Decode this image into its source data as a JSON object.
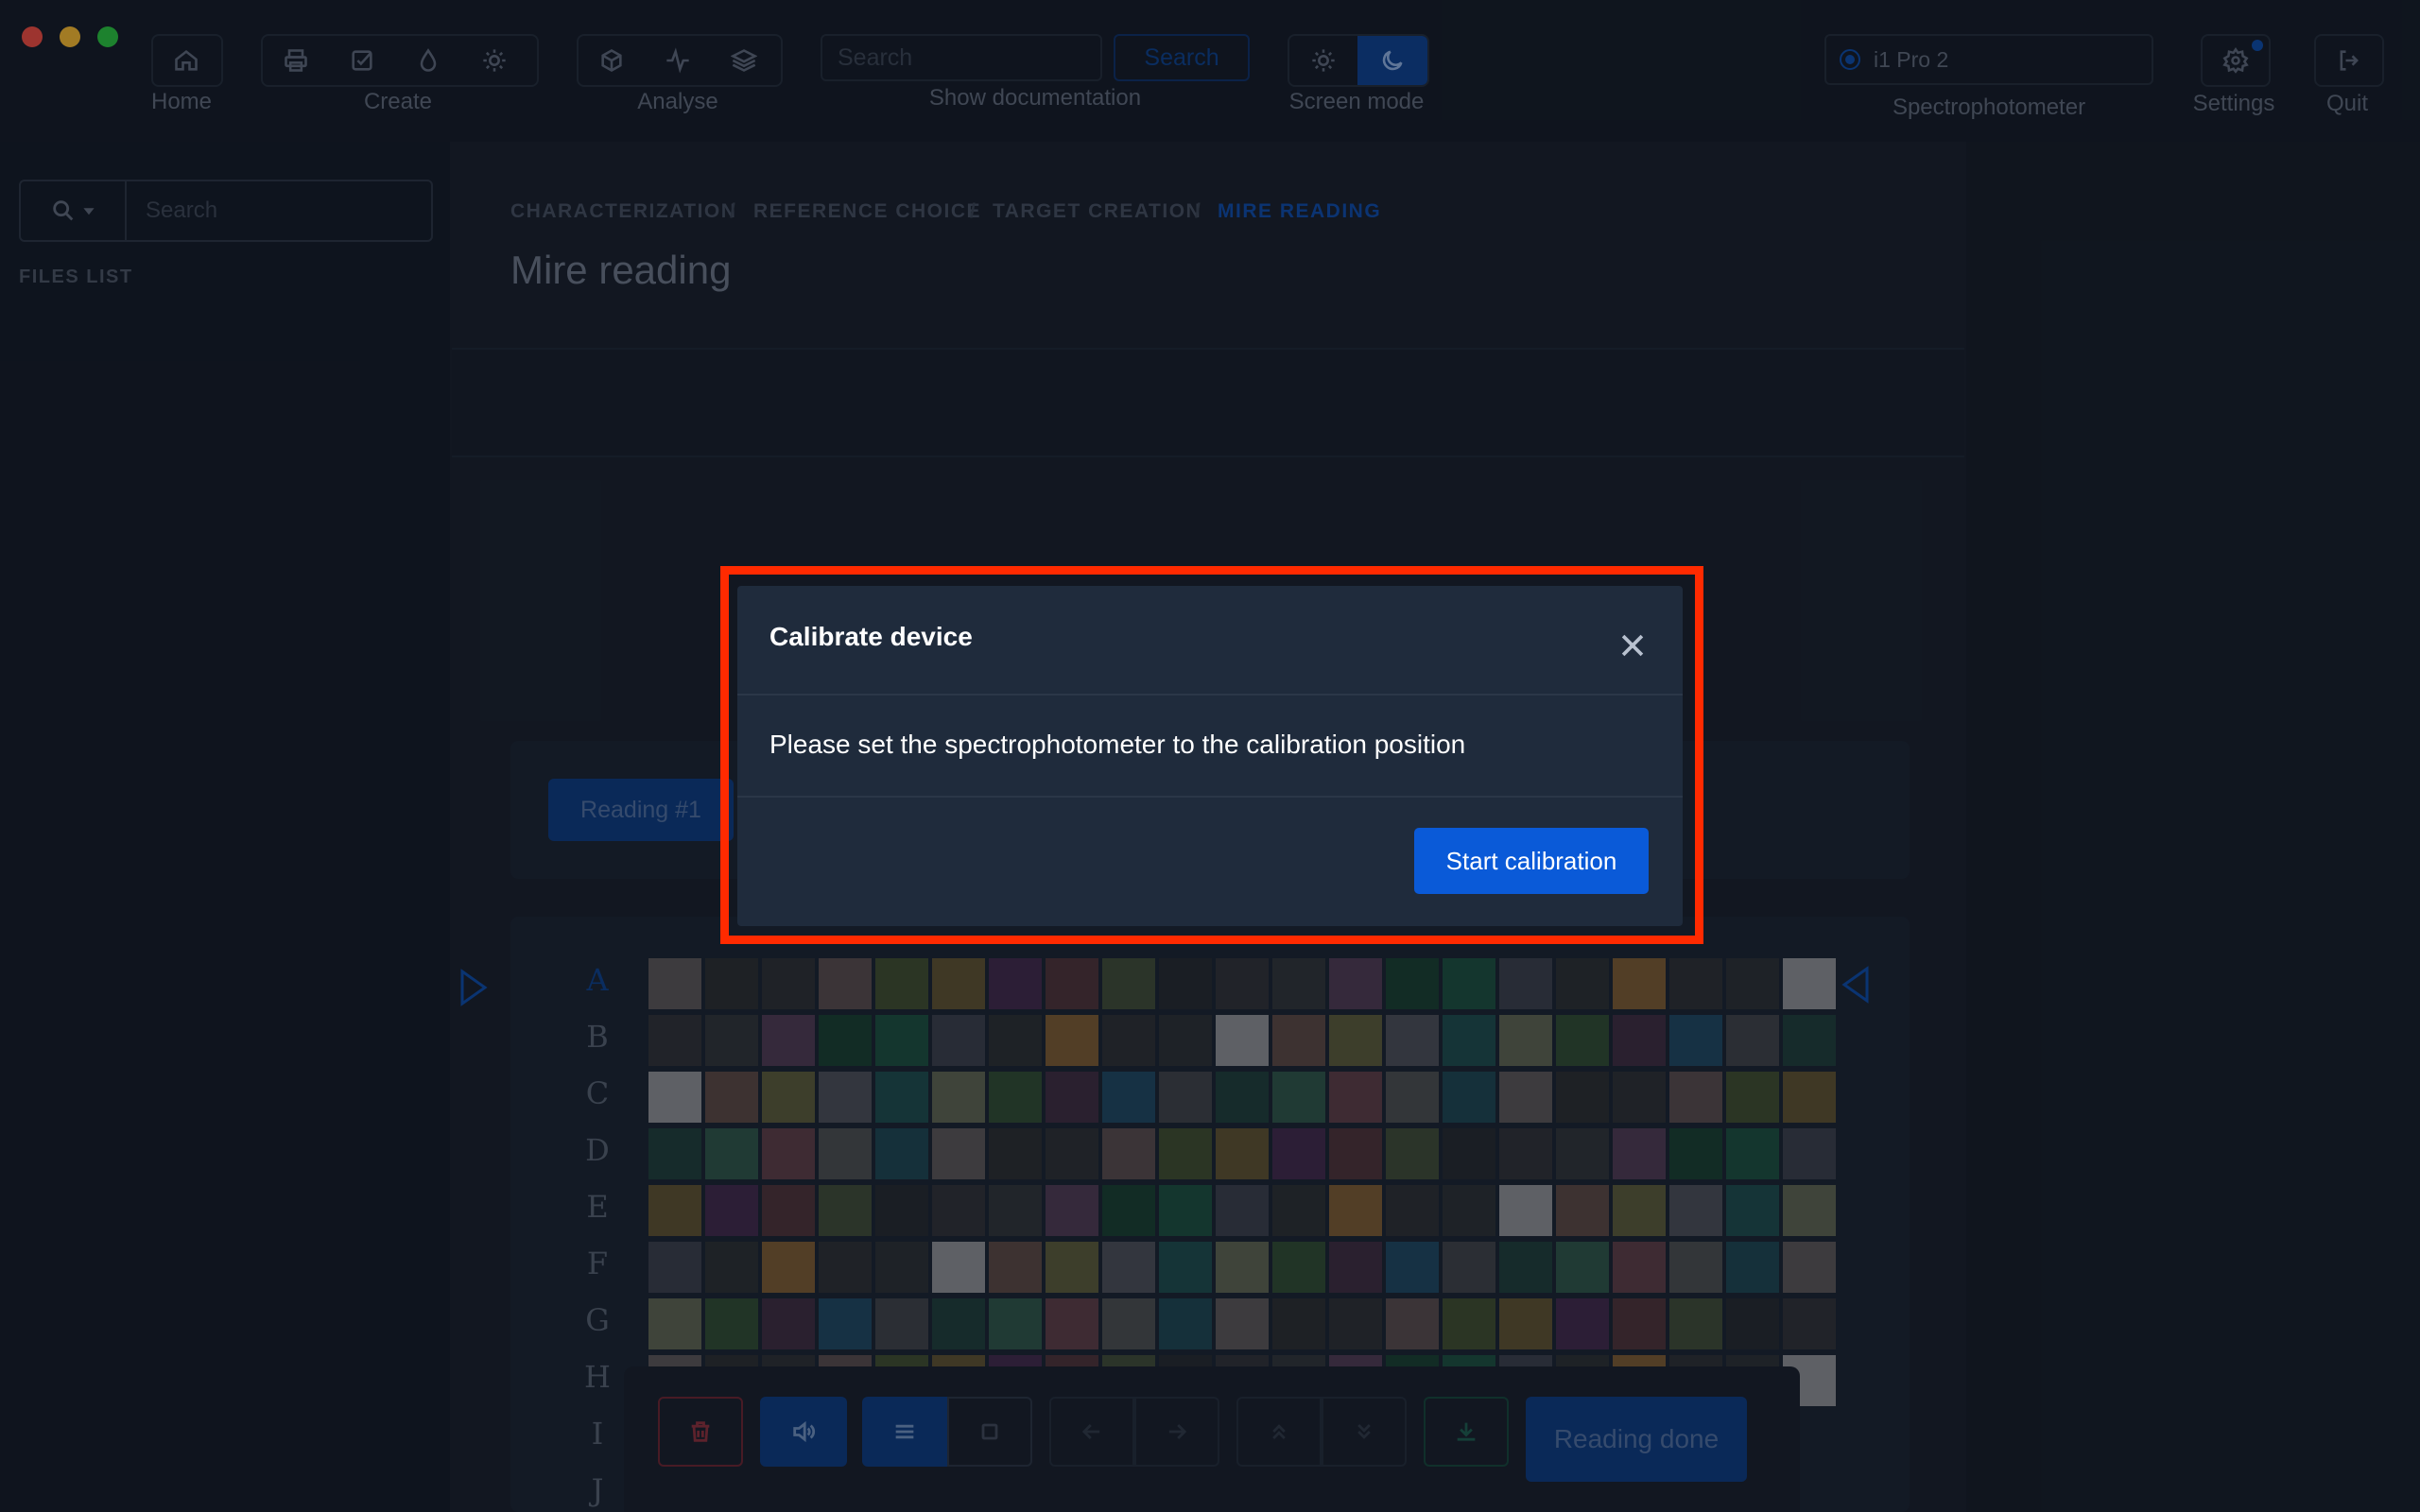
{
  "toolbar": {
    "home_label": "Home",
    "create_label": "Create",
    "analyse_label": "Analyse",
    "search_placeholder": "Search",
    "search_button": "Search",
    "show_documentation": "Show documentation",
    "screen_mode_label": "Screen mode",
    "device_name": "i1 Pro 2",
    "spectrophotometer_label": "Spectrophotometer",
    "settings_label": "Settings",
    "quit_label": "Quit"
  },
  "sidebar": {
    "search_placeholder": "Search",
    "files_list_label": "FILES LIST"
  },
  "breadcrumb": {
    "items": [
      "CHARACTERIZATION",
      "REFERENCE CHOICE",
      "TARGET CREATION",
      "MIRE READING"
    ],
    "separator": "/"
  },
  "page": {
    "title": "Mire reading",
    "reading_tab": "Reading #1",
    "rows": [
      "A",
      "B",
      "C",
      "D",
      "E",
      "F",
      "G",
      "H",
      "I",
      "J"
    ]
  },
  "bottom_toolbar": {
    "reading_done": "Reading done"
  },
  "modal": {
    "title": "Calibrate device",
    "message": "Please set the spectrophotometer to the calibration position",
    "primary_button": "Start calibration"
  },
  "colors": {
    "accent": "#0a5ad8",
    "highlight": "#ff2a00",
    "modal_bg": "#1f2b3c",
    "active_breadcrumb": "#0d4aa8"
  }
}
